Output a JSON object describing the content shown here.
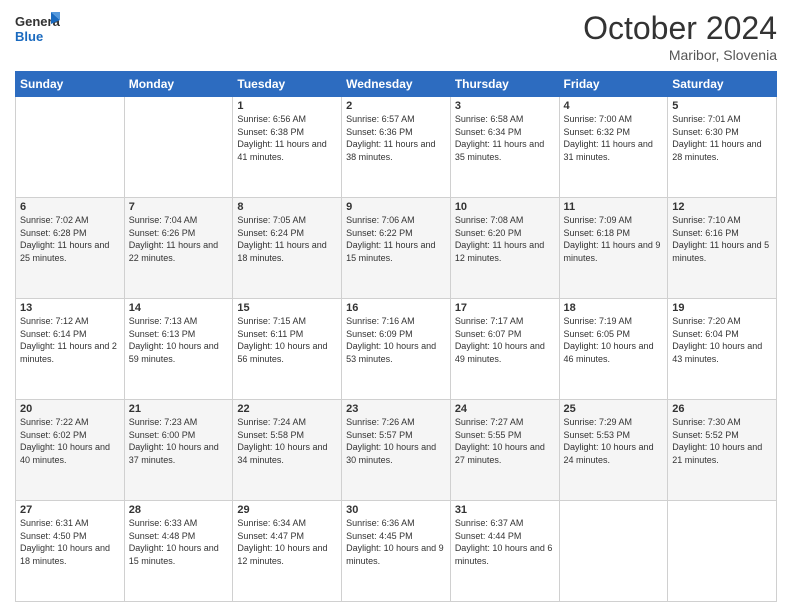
{
  "header": {
    "logo_line1": "General",
    "logo_line2": "Blue",
    "month": "October 2024",
    "location": "Maribor, Slovenia"
  },
  "weekdays": [
    "Sunday",
    "Monday",
    "Tuesday",
    "Wednesday",
    "Thursday",
    "Friday",
    "Saturday"
  ],
  "weeks": [
    [
      {
        "day": "",
        "info": ""
      },
      {
        "day": "",
        "info": ""
      },
      {
        "day": "1",
        "info": "Sunrise: 6:56 AM\nSunset: 6:38 PM\nDaylight: 11 hours and 41 minutes."
      },
      {
        "day": "2",
        "info": "Sunrise: 6:57 AM\nSunset: 6:36 PM\nDaylight: 11 hours and 38 minutes."
      },
      {
        "day": "3",
        "info": "Sunrise: 6:58 AM\nSunset: 6:34 PM\nDaylight: 11 hours and 35 minutes."
      },
      {
        "day": "4",
        "info": "Sunrise: 7:00 AM\nSunset: 6:32 PM\nDaylight: 11 hours and 31 minutes."
      },
      {
        "day": "5",
        "info": "Sunrise: 7:01 AM\nSunset: 6:30 PM\nDaylight: 11 hours and 28 minutes."
      }
    ],
    [
      {
        "day": "6",
        "info": "Sunrise: 7:02 AM\nSunset: 6:28 PM\nDaylight: 11 hours and 25 minutes."
      },
      {
        "day": "7",
        "info": "Sunrise: 7:04 AM\nSunset: 6:26 PM\nDaylight: 11 hours and 22 minutes."
      },
      {
        "day": "8",
        "info": "Sunrise: 7:05 AM\nSunset: 6:24 PM\nDaylight: 11 hours and 18 minutes."
      },
      {
        "day": "9",
        "info": "Sunrise: 7:06 AM\nSunset: 6:22 PM\nDaylight: 11 hours and 15 minutes."
      },
      {
        "day": "10",
        "info": "Sunrise: 7:08 AM\nSunset: 6:20 PM\nDaylight: 11 hours and 12 minutes."
      },
      {
        "day": "11",
        "info": "Sunrise: 7:09 AM\nSunset: 6:18 PM\nDaylight: 11 hours and 9 minutes."
      },
      {
        "day": "12",
        "info": "Sunrise: 7:10 AM\nSunset: 6:16 PM\nDaylight: 11 hours and 5 minutes."
      }
    ],
    [
      {
        "day": "13",
        "info": "Sunrise: 7:12 AM\nSunset: 6:14 PM\nDaylight: 11 hours and 2 minutes."
      },
      {
        "day": "14",
        "info": "Sunrise: 7:13 AM\nSunset: 6:13 PM\nDaylight: 10 hours and 59 minutes."
      },
      {
        "day": "15",
        "info": "Sunrise: 7:15 AM\nSunset: 6:11 PM\nDaylight: 10 hours and 56 minutes."
      },
      {
        "day": "16",
        "info": "Sunrise: 7:16 AM\nSunset: 6:09 PM\nDaylight: 10 hours and 53 minutes."
      },
      {
        "day": "17",
        "info": "Sunrise: 7:17 AM\nSunset: 6:07 PM\nDaylight: 10 hours and 49 minutes."
      },
      {
        "day": "18",
        "info": "Sunrise: 7:19 AM\nSunset: 6:05 PM\nDaylight: 10 hours and 46 minutes."
      },
      {
        "day": "19",
        "info": "Sunrise: 7:20 AM\nSunset: 6:04 PM\nDaylight: 10 hours and 43 minutes."
      }
    ],
    [
      {
        "day": "20",
        "info": "Sunrise: 7:22 AM\nSunset: 6:02 PM\nDaylight: 10 hours and 40 minutes."
      },
      {
        "day": "21",
        "info": "Sunrise: 7:23 AM\nSunset: 6:00 PM\nDaylight: 10 hours and 37 minutes."
      },
      {
        "day": "22",
        "info": "Sunrise: 7:24 AM\nSunset: 5:58 PM\nDaylight: 10 hours and 34 minutes."
      },
      {
        "day": "23",
        "info": "Sunrise: 7:26 AM\nSunset: 5:57 PM\nDaylight: 10 hours and 30 minutes."
      },
      {
        "day": "24",
        "info": "Sunrise: 7:27 AM\nSunset: 5:55 PM\nDaylight: 10 hours and 27 minutes."
      },
      {
        "day": "25",
        "info": "Sunrise: 7:29 AM\nSunset: 5:53 PM\nDaylight: 10 hours and 24 minutes."
      },
      {
        "day": "26",
        "info": "Sunrise: 7:30 AM\nSunset: 5:52 PM\nDaylight: 10 hours and 21 minutes."
      }
    ],
    [
      {
        "day": "27",
        "info": "Sunrise: 6:31 AM\nSunset: 4:50 PM\nDaylight: 10 hours and 18 minutes."
      },
      {
        "day": "28",
        "info": "Sunrise: 6:33 AM\nSunset: 4:48 PM\nDaylight: 10 hours and 15 minutes."
      },
      {
        "day": "29",
        "info": "Sunrise: 6:34 AM\nSunset: 4:47 PM\nDaylight: 10 hours and 12 minutes."
      },
      {
        "day": "30",
        "info": "Sunrise: 6:36 AM\nSunset: 4:45 PM\nDaylight: 10 hours and 9 minutes."
      },
      {
        "day": "31",
        "info": "Sunrise: 6:37 AM\nSunset: 4:44 PM\nDaylight: 10 hours and 6 minutes."
      },
      {
        "day": "",
        "info": ""
      },
      {
        "day": "",
        "info": ""
      }
    ]
  ]
}
